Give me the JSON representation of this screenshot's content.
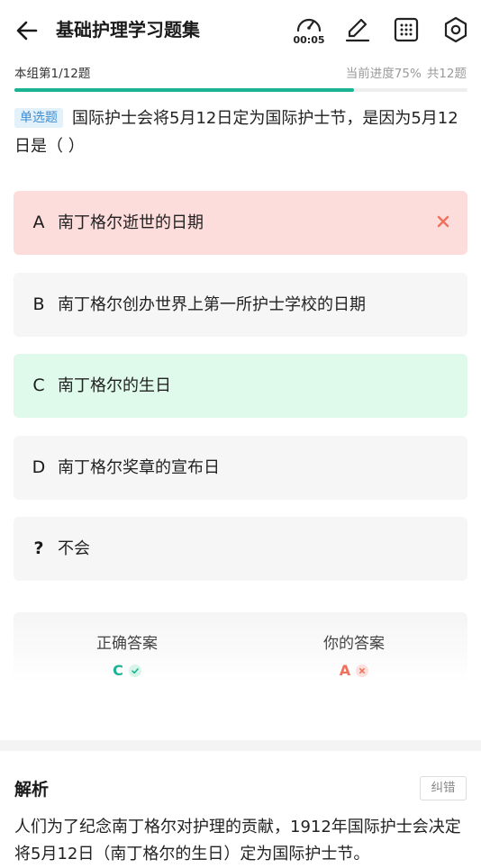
{
  "header": {
    "title": "基础护理学习题集",
    "timer": "00:05"
  },
  "progress": {
    "group_label": "本组第1/12题",
    "current_label": "当前进度75%",
    "total_label": "共12题",
    "fraction": 0.75
  },
  "question": {
    "type_label": "单选题",
    "text": "国际护士会将5月12日定为国际护士节，是因为5月12日是（    ）"
  },
  "options": [
    {
      "letter": "A",
      "text": "南丁格尔逝世的日期",
      "state": "wrong"
    },
    {
      "letter": "B",
      "text": "南丁格尔创办世界上第一所护士学校的日期",
      "state": "normal"
    },
    {
      "letter": "C",
      "text": "南丁格尔的生日",
      "state": "correct"
    },
    {
      "letter": "D",
      "text": "南丁格尔奖章的宣布日",
      "state": "normal"
    },
    {
      "letter": "?",
      "text": "不会",
      "state": "normal"
    }
  ],
  "answer": {
    "correct_label": "正确答案",
    "correct_value": "C",
    "yours_label": "你的答案",
    "yours_value": "A"
  },
  "analysis": {
    "title": "解析",
    "report_label": "纠错",
    "text": "人们为了纪念南丁格尔对护理的贡献，1912年国际护士会决定将5月12日（南丁格尔的生日）定为国际护士节。"
  },
  "colors": {
    "accent": "#1ab394",
    "wrong": "#f0715b",
    "wrong_bg": "#fddcdc",
    "correct_bg": "#dffaeb"
  }
}
